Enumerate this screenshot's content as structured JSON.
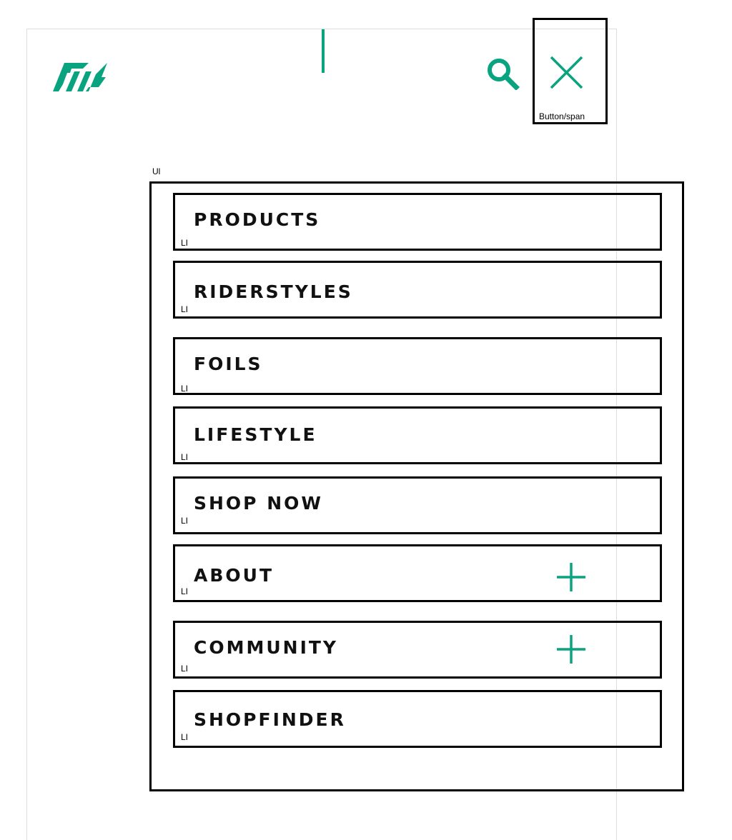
{
  "header": {
    "logo_icon": "brand-logo-icon",
    "search_icon": "search-icon",
    "close_icon": "close-icon",
    "close_debug_label": "Button/span",
    "accent_color": "#0aa37f"
  },
  "menu": {
    "debug_label": "Ul",
    "item_debug_label": "LI",
    "expand_icon": "plus-icon",
    "items": [
      {
        "label": "PRODUCTS",
        "expandable": false
      },
      {
        "label": "RIDERSTYLES",
        "expandable": false
      },
      {
        "label": "FOILS",
        "expandable": false
      },
      {
        "label": "LIFESTYLE",
        "expandable": false
      },
      {
        "label": "SHOP NOW",
        "expandable": false
      },
      {
        "label": "ABOUT",
        "expandable": true
      },
      {
        "label": "COMMUNITY",
        "expandable": true
      },
      {
        "label": "SHOPFINDER",
        "expandable": false
      }
    ]
  }
}
